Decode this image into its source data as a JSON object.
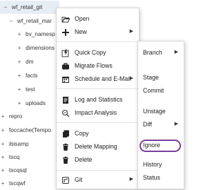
{
  "tree": [
    {
      "sign": "−",
      "label": "wf_retail_git",
      "selected": true
    },
    {
      "sign": "−",
      "label": "wf_retail_mar"
    },
    {
      "sign": "+",
      "label": "bv_namesp"
    },
    {
      "sign": "+",
      "label": "dimensions"
    },
    {
      "sign": "+",
      "label": "dm"
    },
    {
      "sign": "+",
      "label": "facts"
    },
    {
      "sign": "+",
      "label": "test"
    },
    {
      "sign": "+",
      "label": "uploads"
    },
    {
      "sign": "+",
      "label": "repro"
    },
    {
      "sign": "+",
      "label": "foccache(Tempo"
    },
    {
      "sign": "+",
      "label": "ibisamp"
    },
    {
      "sign": "+",
      "label": "tscq"
    },
    {
      "sign": "+",
      "label": "tscqsql"
    },
    {
      "sign": "+",
      "label": "tscqwf"
    }
  ],
  "context_menu": {
    "open": "Open",
    "new": "New",
    "quick_copy": "Quick Copy",
    "migrate_flows": "Migrate Flows",
    "schedule_email": "Schedule and E-Mail",
    "log_statistics": "Log and Statistics",
    "impact_analysis": "Impact Analysis",
    "copy": "Copy",
    "delete_mapping": "Delete Mapping",
    "delete": "Delete",
    "git": "Git",
    "submenu_arrow": "▶"
  },
  "git_submenu": {
    "branch": "Branch",
    "stage": "Stage",
    "commit": "Commit",
    "unstage": "Unstage",
    "diff": "Diff",
    "ignore": "Ignore",
    "history": "History",
    "status": "Status"
  }
}
